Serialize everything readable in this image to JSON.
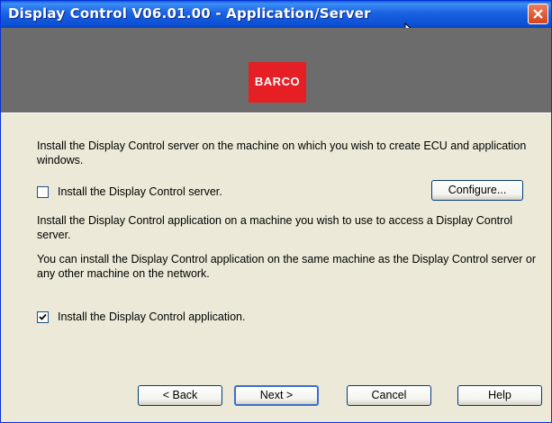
{
  "window": {
    "title": "Display Control V06.01.00 - Application/Server"
  },
  "banner": {
    "logo_text": "BARCO"
  },
  "server": {
    "description": "Install the Display Control server on the machine on which you wish to create ECU and application windows.",
    "checkbox_label": "Install the Display Control server.",
    "checked": false,
    "configure_label": "Configure..."
  },
  "application": {
    "description1": "Install the Display Control application on a machine you wish to use to access a Display Control server.",
    "description2": "You can install the Display Control application on the same machine as the Display Control server or any other machine on the network.",
    "checkbox_label": "Install the Display Control application.",
    "checked": true
  },
  "buttons": {
    "back": "< Back",
    "next": "Next >",
    "cancel": "Cancel",
    "help": "Help"
  },
  "icons": {
    "close": "close-icon",
    "cursor": "mouse-cursor-icon",
    "check": "checkmark-icon"
  },
  "colors": {
    "title_bar": "#0c4fd2",
    "banner": "#6c6c6c",
    "logo": "#e51f23",
    "dialog": "#ece9d8"
  }
}
